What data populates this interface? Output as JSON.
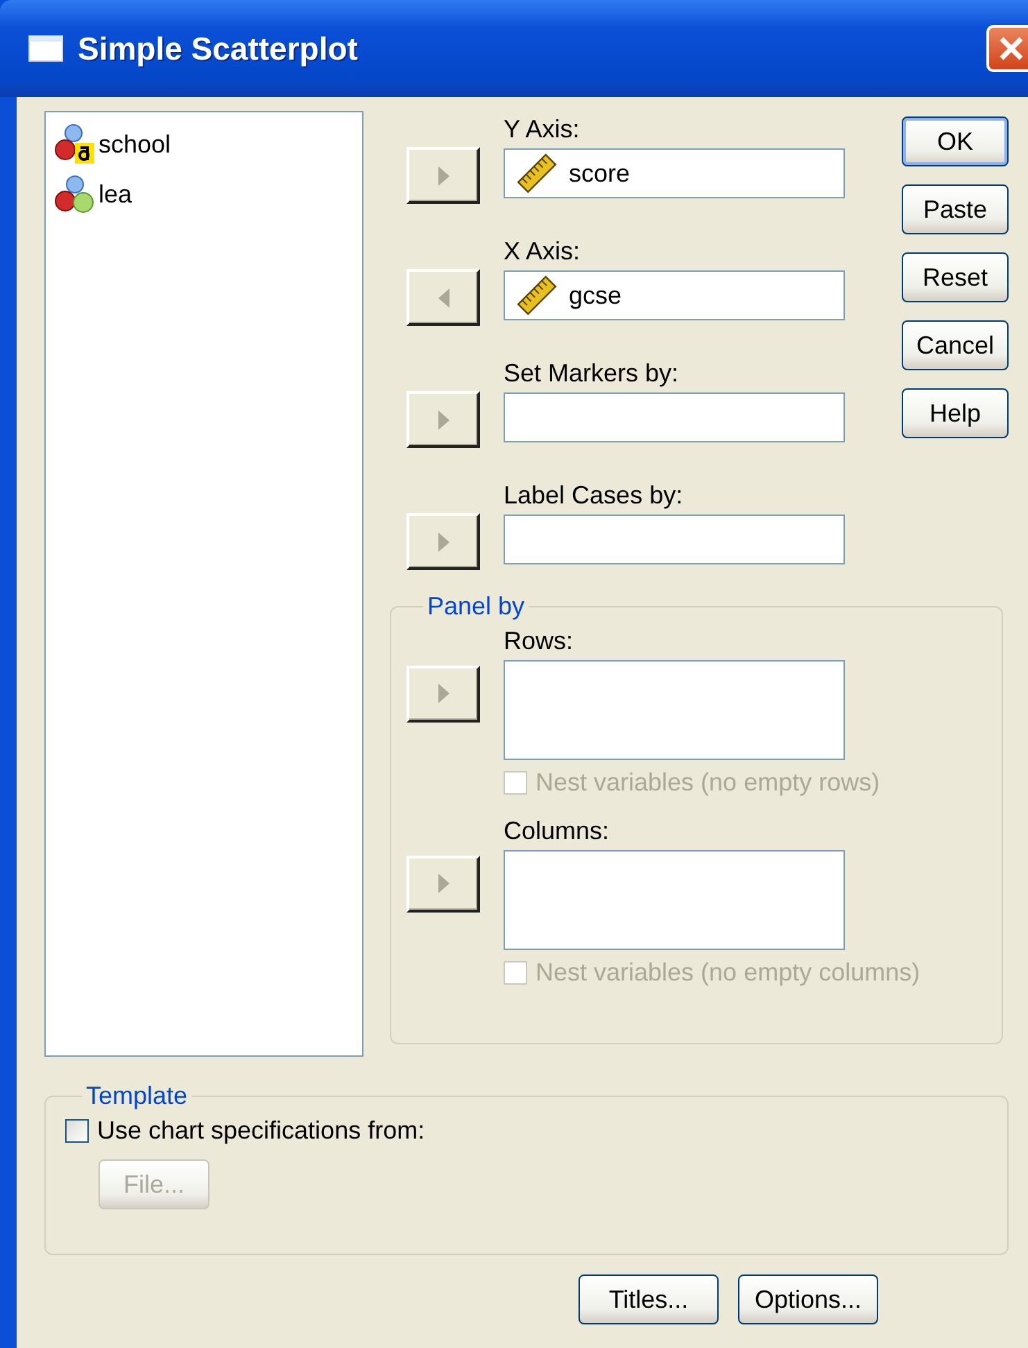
{
  "window": {
    "title": "Simple Scatterplot"
  },
  "variables": [
    {
      "name": "school",
      "kind": "string"
    },
    {
      "name": "lea",
      "kind": "nominal"
    }
  ],
  "slots": [
    {
      "label": "Y Axis:",
      "kind": "add",
      "value": {
        "text": "score",
        "kind": "scale"
      }
    },
    {
      "label": "X Axis:",
      "kind": "remove",
      "value": {
        "text": "gcse",
        "kind": "scale"
      }
    },
    {
      "label": "Set Markers by:",
      "kind": "add"
    },
    {
      "label": "Label Cases by:",
      "kind": "add"
    }
  ],
  "buttons": [
    {
      "label": "OK",
      "default": true
    },
    {
      "label": "Paste",
      "default": false
    },
    {
      "label": "Reset",
      "default": false
    },
    {
      "label": "Cancel",
      "default": false
    },
    {
      "label": "Help",
      "default": false
    }
  ],
  "panel_by": {
    "title": "Panel by",
    "sections": [
      {
        "label": "Rows:",
        "kind": "add",
        "nest_label": "Nest variables (no empty rows)",
        "nest_checked": false,
        "nest_disabled": true
      },
      {
        "label": "Columns:",
        "kind": "add",
        "nest_label": "Nest variables (no empty columns)",
        "nest_checked": false,
        "nest_disabled": true
      }
    ]
  },
  "template": {
    "title": "Template",
    "checkbox_label": "Use chart specifications from:",
    "checked": false,
    "file_button": "File...",
    "file_disabled": true
  },
  "footer_buttons": [
    "Titles...",
    "Options..."
  ]
}
